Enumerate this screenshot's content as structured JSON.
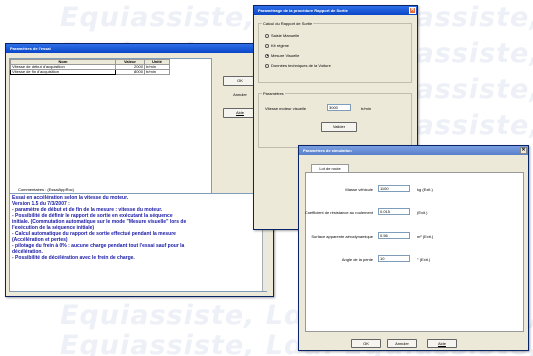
{
  "watermark": {
    "lines": [
      "Equiassiste, Lda.   Equiassiste, Lda.",
      "Equiassiste, Lda.   Equiassiste, Lda.",
      "Equiassiste, Lda.   Equiassiste, Lda.",
      "Equiassiste, Lda.   Equiassiste, Lda.",
      "Equiassiste, Lda.   Equiassiste, Lda.",
      "Equiassiste, Lda.   Equiassiste, Lda."
    ]
  },
  "essai": {
    "title": "Paramètres de l'essai",
    "table": {
      "headers": [
        "Nom",
        "Valeur",
        "Unité"
      ],
      "rows": [
        [
          "Vitesse de début d'acquisition",
          "2000",
          "tr/min"
        ],
        [
          "Vitesse de fin d'acquisition",
          "8000",
          "tr/min"
        ]
      ]
    },
    "buttons": {
      "ok": "OK",
      "cancel": "Annuler",
      "help": "Aide"
    },
    "comments_label": "Commentaires : (EssaiAppRoc)",
    "comment_lines": [
      "Essai en accélération selon la vitesse du moteur.",
      "Version 1.5 du 7/3/2007 :",
      "- paramètre de début et de fin de la mesure : vitesse du moteur.",
      "- Possibilité de définir le rapport de sortie en exécutant la séquence",
      "initiale. (Commutation automatique sur le mode \"Mesure visuelle\" lors de",
      "l'exécution de la séquence initiale)",
      "- Calcul automatique du rapport de sortie effectué pendant la mesure",
      "(Accélération et pertes)",
      "- pilotage du frein à 0% : aucune charge pendant tout l'essai sauf pour la",
      "décélération.",
      "- Possibilité de décélération avec le frein de charge."
    ]
  },
  "rapport": {
    "title": "Paramétrage de la procédure Rapport de Sortie",
    "calc_group": "Calcul du Rapport de Sortie",
    "options": [
      {
        "label": "Saisie Manuelle",
        "selected": false
      },
      {
        "label": "Kit régime",
        "selected": false
      },
      {
        "label": "Mesure Visuelle",
        "selected": true
      },
      {
        "label": "Données techniques de la Voiture",
        "selected": false
      }
    ],
    "params_group": "Paramètres",
    "speed_label": "Vitesse moteur visuelle",
    "speed_value": "3000",
    "speed_unit": "tr/min",
    "validate": "Valider"
  },
  "simulation": {
    "title": "Paramètres de simulation",
    "tab": "Lot de route",
    "fields": [
      {
        "label": "Masse véhicule",
        "value": "1100",
        "unit": "kg (Exit.)"
      },
      {
        "label": "Coefficient de résistance au roulement",
        "value": "0.015",
        "unit": "(Exit.)"
      },
      {
        "label": "Surface apparente aérodynamique",
        "value": "0.56",
        "unit": "m² (Exit.)"
      },
      {
        "label": "Angle de la pente",
        "value": "10",
        "unit": "° (Exit.)"
      }
    ],
    "buttons": {
      "ok": "OK",
      "cancel": "Annuler",
      "help": "Aide"
    }
  }
}
